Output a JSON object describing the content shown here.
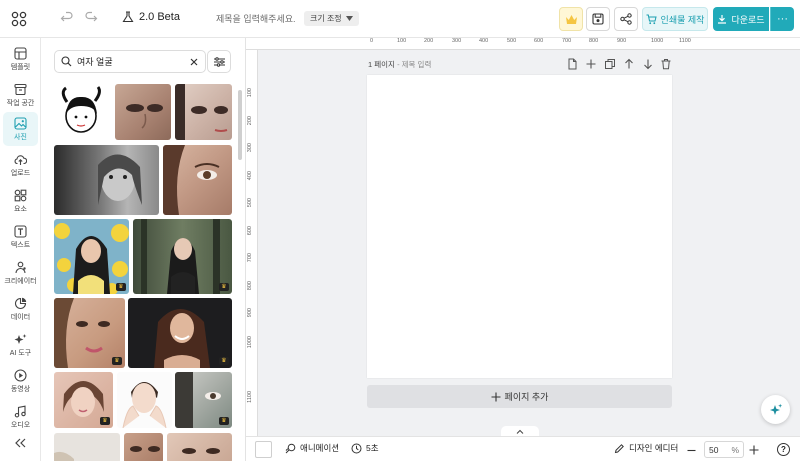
{
  "topbar": {
    "version": "2.0 Beta",
    "title_placeholder": "제목을 입력해주세요.",
    "resize_label": "크기 조정",
    "print_label": "인쇄물 제작",
    "download_label": "다운로드",
    "more_label": "···"
  },
  "rail": {
    "items": [
      {
        "label": "템플릿",
        "icon": "template-icon"
      },
      {
        "label": "작업 공간",
        "icon": "workspace-icon"
      },
      {
        "label": "사진",
        "icon": "photo-icon",
        "active": true
      },
      {
        "label": "업로드",
        "icon": "upload-icon"
      },
      {
        "label": "요소",
        "icon": "elements-icon"
      },
      {
        "label": "텍스트",
        "icon": "text-icon"
      },
      {
        "label": "크리에이터",
        "icon": "creator-icon"
      },
      {
        "label": "데이터",
        "icon": "data-icon"
      },
      {
        "label": "AI 도구",
        "icon": "ai-tools-icon"
      },
      {
        "label": "동영상",
        "icon": "video-icon"
      },
      {
        "label": "오디오",
        "icon": "audio-icon"
      }
    ],
    "collapse_icon": "collapse-icon"
  },
  "panel": {
    "search_value": "여자 얼굴",
    "crown_glyph": "♛"
  },
  "canvas": {
    "page_label": "1 페이지",
    "page_title_placeholder": "제목 입력",
    "add_page_label": "페이지 추가",
    "ruler_top": [
      "0",
      "100",
      "200",
      "300",
      "400",
      "500",
      "600",
      "700",
      "800",
      "900",
      "1000",
      "1100"
    ],
    "ruler_left": [
      "100",
      "200",
      "300",
      "400",
      "500",
      "600",
      "700",
      "800",
      "900",
      "1000",
      "1100"
    ]
  },
  "bottombar": {
    "animation_label": "애니메이션",
    "duration_label": "5초",
    "design_editor_label": "디자인 에디터",
    "zoom_value": "50",
    "zoom_unit": "%",
    "help_label": "?"
  },
  "colors": {
    "accent": "#21aab9",
    "crown": "#f5c542"
  }
}
